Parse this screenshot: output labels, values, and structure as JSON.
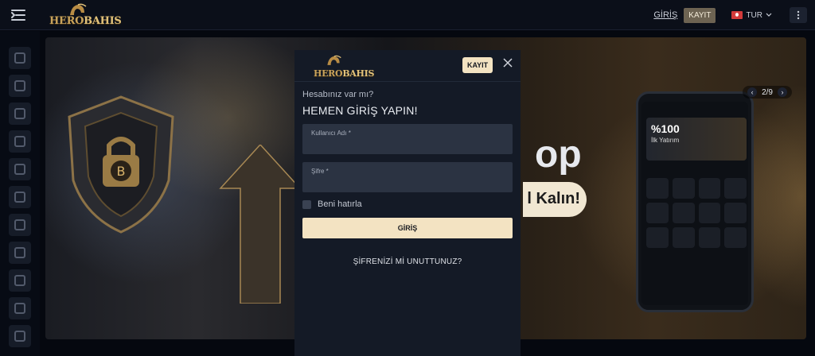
{
  "header": {
    "logo_text_a": "HERO",
    "logo_text_b": "BAHIS",
    "login_link": "GİRİŞ",
    "register_button": "KAYIT",
    "language": "TUR"
  },
  "sidebar": {
    "items": [
      {
        "icon": "slots-icon"
      },
      {
        "icon": "casino-icon"
      },
      {
        "icon": "soccer-ball-icon"
      },
      {
        "icon": "gift-icon"
      },
      {
        "icon": "speedometer-icon"
      },
      {
        "icon": "gamepad-icon"
      },
      {
        "icon": "poker-chips-icon"
      },
      {
        "icon": "chart-icon"
      },
      {
        "icon": "wheel-icon"
      },
      {
        "icon": "card-icon"
      },
      {
        "icon": "tv-icon"
      }
    ]
  },
  "banner": {
    "slide_indicator": "2/9",
    "text_fragment_1": "op",
    "text_fragment_2": "l Kalın!",
    "phone_promo_big": "%100",
    "phone_promo_small": "İlk Yatırım"
  },
  "modal": {
    "logo_text_a": "HERO",
    "logo_text_b": "BAHIS",
    "register_button": "KAYIT",
    "subtitle": "Hesabınız var mı?",
    "title": "HEMEN GİRİŞ YAPIN!",
    "username_placeholder": "Kullanıcı Adı *",
    "password_placeholder": "Şifre *",
    "remember_label": "Beni hatırla",
    "login_button": "GİRİŞ",
    "forgot_link": "ŞİFRENİZİ Mİ UNUTTUNUZ?"
  },
  "colors": {
    "accent": "#f3e3c2",
    "background": "#05080f",
    "modal_bg": "#141a26",
    "field_bg": "#2b3342"
  }
}
